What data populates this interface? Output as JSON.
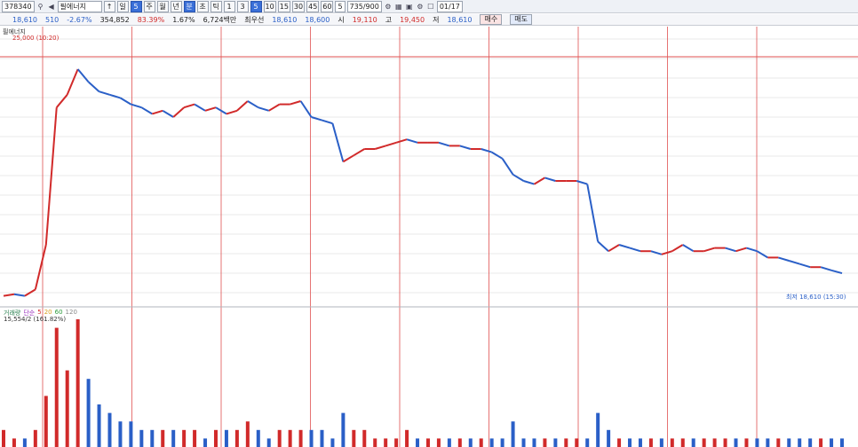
{
  "toolbar": {
    "code": "378340",
    "name": "필에너지",
    "period_buttons": [
      "일",
      "5",
      "주",
      "월",
      "년",
      "분",
      "초",
      "틱"
    ],
    "active_period": "5",
    "minute_buttons": [
      "1",
      "3",
      "5",
      "10",
      "15",
      "30",
      "45",
      "60"
    ],
    "active_minute": "5",
    "count_select": "5",
    "page_count": "735/900",
    "date": "01/17"
  },
  "info": {
    "price": "18,610",
    "change": "510",
    "change_pct": "-2.67%",
    "volume": "354,852",
    "ratio1": "83.39%",
    "ratio2": "1.67%",
    "amount": "6,724백만",
    "best_ask_label": "최우선",
    "best_ask": "18,610",
    "best_bid": "18,600",
    "open_label": "시",
    "open": "19,110",
    "high_label": "고",
    "high": "19,450",
    "low_label": "저",
    "low": "18,610",
    "buy_label": "매수",
    "sell_label": "매도"
  },
  "chart_labels": {
    "series_name": "필에너지",
    "high_marker": "25,000 (10:20)",
    "low_marker": "최저 18,610 (15:30)",
    "volume_legend": [
      "거래량",
      "단순",
      "5",
      "20",
      "60",
      "120"
    ],
    "volume_value": "15,554/2 (161.82%)"
  },
  "colors": {
    "up": "#d12a2a",
    "down": "#2a5fc7",
    "divider": "#e05050",
    "grid": "#e8e8e8"
  },
  "chart_data": {
    "type": "line",
    "title": "",
    "xlabel": "",
    "ylabel": "",
    "ylim": [
      18000,
      25500
    ],
    "session_count": 9,
    "high": 25000,
    "low": 18610,
    "price_series": {
      "name": "",
      "values": [
        17900,
        17950,
        17900,
        18100,
        19500,
        23800,
        24200,
        25000,
        24600,
        24300,
        24200,
        24100,
        23900,
        23800,
        23600,
        23700,
        23500,
        23800,
        23900,
        23700,
        23800,
        23600,
        23700,
        24000,
        23800,
        23700,
        23900,
        23900,
        24000,
        23500,
        23400,
        23300,
        22100,
        22300,
        22500,
        22500,
        22600,
        22700,
        22800,
        22700,
        22700,
        22700,
        22600,
        22600,
        22500,
        22500,
        22400,
        22200,
        21700,
        21500,
        21400,
        21600,
        21500,
        21500,
        21500,
        21400,
        19600,
        19300,
        19500,
        19400,
        19300,
        19300,
        19200,
        19300,
        19500,
        19300,
        19300,
        19400,
        19400,
        19300,
        19400,
        19300,
        19100,
        19100,
        19000,
        18900,
        18800,
        18800,
        18700,
        18610
      ]
    },
    "volume_series": {
      "name": "거래량",
      "values": [
        2,
        1,
        1,
        2,
        6,
        14,
        9,
        15,
        8,
        5,
        4,
        3,
        3,
        2,
        2,
        2,
        2,
        2,
        2,
        1,
        2,
        2,
        2,
        3,
        2,
        1,
        2,
        2,
        2,
        2,
        2,
        1,
        4,
        2,
        2,
        1,
        1,
        1,
        2,
        1,
        1,
        1,
        1,
        1,
        1,
        1,
        1,
        1,
        3,
        1,
        1,
        1,
        1,
        1,
        1,
        1,
        4,
        2,
        1,
        1,
        1,
        1,
        1,
        1,
        1,
        1,
        1,
        1,
        1,
        1,
        1,
        1,
        1,
        1,
        1,
        1,
        1,
        1,
        1,
        1
      ]
    }
  }
}
